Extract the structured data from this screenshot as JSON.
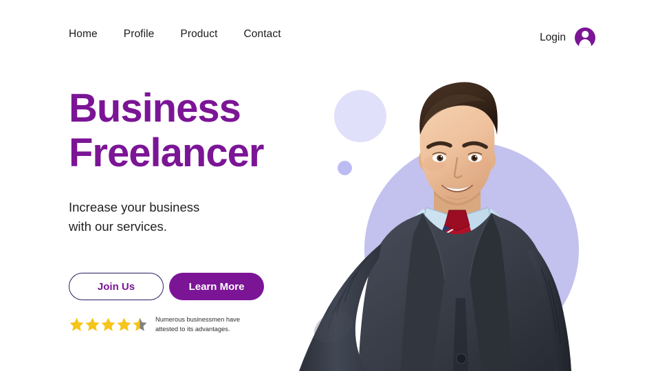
{
  "page": {
    "background_color": "#ffffff",
    "accent_purple": "#7b1596",
    "accent_lavender": "#c3c1ee",
    "accent_lavender_light": "#e1e0fa",
    "outline_navy": "#2b1a5f",
    "star_gold": "#f5c518",
    "star_gray": "#808080"
  },
  "navbar": {
    "links": [
      {
        "label": "Home"
      },
      {
        "label": "Profile"
      },
      {
        "label": "Product"
      },
      {
        "label": "Contact"
      }
    ],
    "login_label": "Login",
    "avatar_icon": "user-avatar-icon"
  },
  "hero": {
    "title_line1": "Business",
    "title_line2": "Freelancer",
    "subtitle_line1": "Increase your business",
    "subtitle_line2": "with our services.",
    "primary_button": "Join Us",
    "secondary_button": "Learn More"
  },
  "rating": {
    "value": 4.5,
    "max": 5,
    "full_stars": 4,
    "half_stars": 1,
    "caption_line1": "Numerous businessmen have",
    "caption_line2": "attested to its advantages."
  },
  "illustration": {
    "subject": "businessman-photo",
    "suit_color": "#3a3f4a",
    "shirt_color": "#bcd6ea",
    "tie_color": "#b01029",
    "tie_stripe_color": "#2a3a6e",
    "skin_color": "#f0c9a8",
    "hair_color": "#3d2a1d",
    "shapes": [
      {
        "name": "circle-big-bg",
        "color": "#c3c1ee"
      },
      {
        "name": "circle-medium",
        "color": "#e1e0fa"
      },
      {
        "name": "circle-small",
        "color": "#bdbcf2"
      }
    ]
  }
}
